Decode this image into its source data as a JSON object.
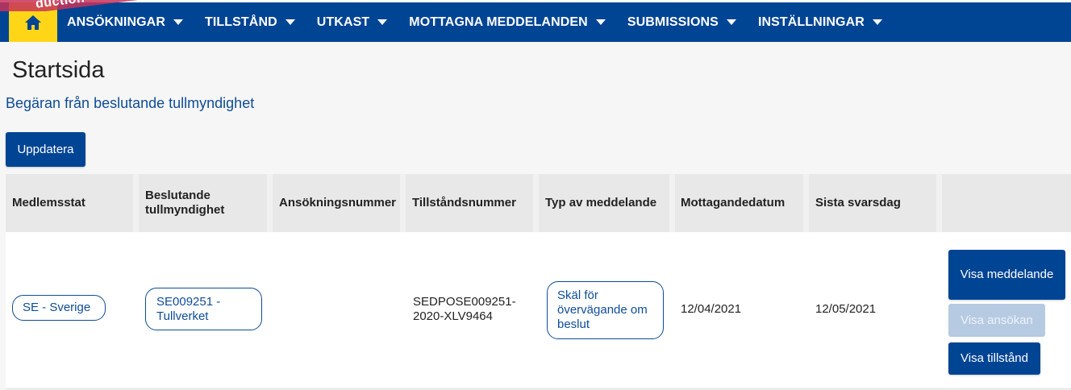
{
  "ribbon": {
    "text": "duction"
  },
  "nav": {
    "home_icon": "home-icon",
    "items": [
      {
        "label": "ANSÖKNINGAR"
      },
      {
        "label": "TILLSTÅND"
      },
      {
        "label": "UTKAST"
      },
      {
        "label": "MOTTAGNA MEDDELANDEN"
      },
      {
        "label": "SUBMISSIONS"
      },
      {
        "label": "INSTÄLLNINGAR"
      }
    ]
  },
  "page": {
    "title": "Startsida",
    "subtitle": "Begäran från beslutande tullmyndighet",
    "refresh_label": "Uppdatera"
  },
  "table": {
    "headers": [
      "Medlemsstat",
      "Beslutande tullmyndighet",
      "Ansökningsnummer",
      "Tillståndsnummer",
      "Typ av meddelande",
      "Mottagandedatum",
      "Sista svarsdag",
      ""
    ],
    "rows": [
      {
        "member_state": "SE - Sverige",
        "authority": "SE009251 - Tullverket",
        "application_number": "",
        "permit_number": "SEDPOSE009251-2020-XLV9464",
        "message_type": "Skäl för övervägande om beslut",
        "received_date": "12/04/2021",
        "deadline": "12/05/2021",
        "actions": {
          "view_message": "Visa meddelande",
          "view_application": "Visa ansökan",
          "view_permit": "Visa tillstånd"
        }
      }
    ]
  },
  "colors": {
    "nav_bg": "#004494",
    "home_bg": "#ffd617",
    "accent_text": "#0e4c97",
    "disabled_btn": "#b6cae2"
  }
}
